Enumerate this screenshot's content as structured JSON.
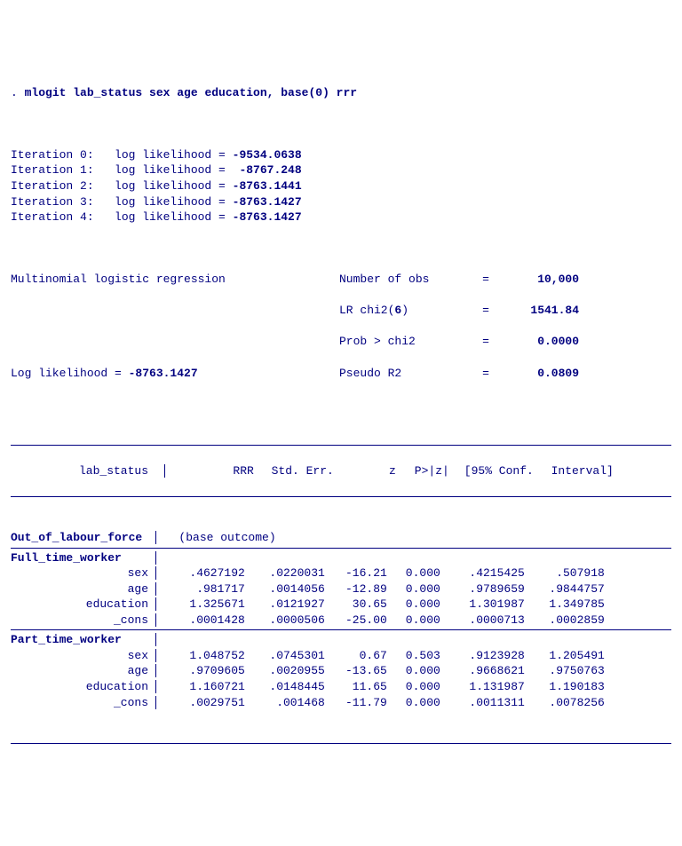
{
  "command": {
    "prompt": ". ",
    "cmd": "mlogit lab_status sex age education, base(0) rrr"
  },
  "iterations": [
    {
      "label": "Iteration 0:",
      "text": "log likelihood =",
      "val": "-9534.0638"
    },
    {
      "label": "Iteration 1:",
      "text": "log likelihood =",
      "val": " -8767.248"
    },
    {
      "label": "Iteration 2:",
      "text": "log likelihood =",
      "val": "-8763.1441"
    },
    {
      "label": "Iteration 3:",
      "text": "log likelihood =",
      "val": "-8763.1427"
    },
    {
      "label": "Iteration 4:",
      "text": "log likelihood =",
      "val": "-8763.1427"
    }
  ],
  "header": {
    "title": "Multinomial logistic regression",
    "loglik_label": "Log likelihood = ",
    "loglik_val": "-8763.1427",
    "stats": [
      {
        "lab": "Number of obs",
        "eq": "=",
        "val": "10,000"
      },
      {
        "lab": "LR chi2(6)",
        "eq": "=",
        "val": "1541.84"
      },
      {
        "lab": "Prob > chi2",
        "eq": "=",
        "val": "0.0000"
      },
      {
        "lab": "Pseudo R2",
        "eq": "=",
        "val": "0.0809"
      }
    ]
  },
  "columns": {
    "depvar": "lab_status",
    "c1": "RRR",
    "c2": "Std. Err.",
    "c3": "z",
    "c4": "P>|z|",
    "c5": "[95% Conf.",
    "c6": "Interval]"
  },
  "groups": [
    {
      "name": "Out_of_labour_force",
      "base": "(base outcome)",
      "rows": []
    },
    {
      "name": "Full_time_worker",
      "rows": [
        {
          "var": "sex",
          "rrr": ".4627192",
          "se": ".0220031",
          "z": "-16.21",
          "p": "0.000",
          "lo": ".4215425",
          "hi": ".507918"
        },
        {
          "var": "age",
          "rrr": ".981717",
          "se": ".0014056",
          "z": "-12.89",
          "p": "0.000",
          "lo": ".9789659",
          "hi": ".9844757"
        },
        {
          "var": "education",
          "rrr": "1.325671",
          "se": ".0121927",
          "z": "30.65",
          "p": "0.000",
          "lo": "1.301987",
          "hi": "1.349785"
        },
        {
          "var": "_cons",
          "rrr": ".0001428",
          "se": ".0000506",
          "z": "-25.00",
          "p": "0.000",
          "lo": ".0000713",
          "hi": ".0002859"
        }
      ]
    },
    {
      "name": "Part_time_worker",
      "rows": [
        {
          "var": "sex",
          "rrr": "1.048752",
          "se": ".0745301",
          "z": "0.67",
          "p": "0.503",
          "lo": ".9123928",
          "hi": "1.205491"
        },
        {
          "var": "age",
          "rrr": ".9709605",
          "se": ".0020955",
          "z": "-13.65",
          "p": "0.000",
          "lo": ".9668621",
          "hi": ".9750763"
        },
        {
          "var": "education",
          "rrr": "1.160721",
          "se": ".0148445",
          "z": "11.65",
          "p": "0.000",
          "lo": "1.131987",
          "hi": "1.190183"
        },
        {
          "var": "_cons",
          "rrr": ".0029751",
          "se": ".001468",
          "z": "-11.79",
          "p": "0.000",
          "lo": ".0011311",
          "hi": ".0078256"
        }
      ]
    }
  ],
  "chart_data": {
    "type": "table",
    "title": "Multinomial logistic regression (RRR)",
    "depvar": "lab_status",
    "base_outcome": "Out_of_labour_force",
    "n_obs": 10000,
    "lr_chi2": 1541.84,
    "df": 6,
    "prob_chi2": 0.0,
    "pseudo_r2": 0.0809,
    "log_likelihood": -8763.1427,
    "outcomes": [
      {
        "outcome": "Full_time_worker",
        "coefs": [
          {
            "var": "sex",
            "rrr": 0.4627192,
            "se": 0.0220031,
            "z": -16.21,
            "p": 0.0,
            "ci": [
              0.4215425,
              0.507918
            ]
          },
          {
            "var": "age",
            "rrr": 0.981717,
            "se": 0.0014056,
            "z": -12.89,
            "p": 0.0,
            "ci": [
              0.9789659,
              0.9844757
            ]
          },
          {
            "var": "education",
            "rrr": 1.325671,
            "se": 0.0121927,
            "z": 30.65,
            "p": 0.0,
            "ci": [
              1.301987,
              1.349785
            ]
          },
          {
            "var": "_cons",
            "rrr": 0.0001428,
            "se": 5.06e-05,
            "z": -25.0,
            "p": 0.0,
            "ci": [
              7.13e-05,
              0.0002859
            ]
          }
        ]
      },
      {
        "outcome": "Part_time_worker",
        "coefs": [
          {
            "var": "sex",
            "rrr": 1.048752,
            "se": 0.0745301,
            "z": 0.67,
            "p": 0.503,
            "ci": [
              0.9123928,
              1.205491
            ]
          },
          {
            "var": "age",
            "rrr": 0.9709605,
            "se": 0.0020955,
            "z": -13.65,
            "p": 0.0,
            "ci": [
              0.9668621,
              0.9750763
            ]
          },
          {
            "var": "education",
            "rrr": 1.160721,
            "se": 0.0148445,
            "z": 11.65,
            "p": 0.0,
            "ci": [
              1.131987,
              1.190183
            ]
          },
          {
            "var": "_cons",
            "rrr": 0.0029751,
            "se": 0.001468,
            "z": -11.79,
            "p": 0.0,
            "ci": [
              0.0011311,
              0.0078256
            ]
          }
        ]
      }
    ]
  }
}
